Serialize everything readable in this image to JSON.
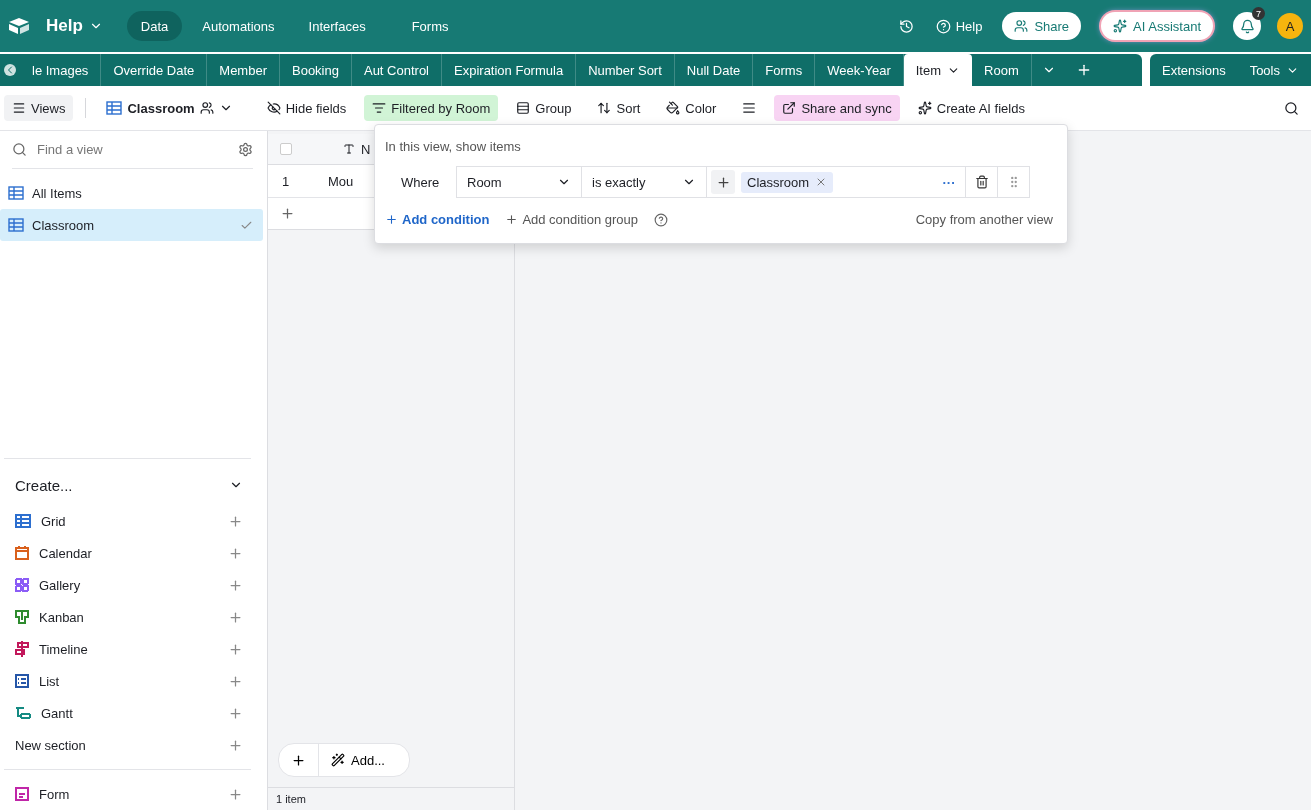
{
  "top_bar": {
    "base_name": "Help",
    "nav": [
      {
        "label": "Data",
        "selected": true
      },
      {
        "label": "Automations",
        "selected": false
      },
      {
        "label": "Interfaces",
        "selected": false
      },
      {
        "label": "Forms",
        "selected": false
      }
    ],
    "help": "Help",
    "share": "Share",
    "ai_assistant": "AI Assistant",
    "notification_count": "7",
    "avatar": "A"
  },
  "table_tabs": {
    "items": [
      {
        "label": "le Images",
        "selected": false,
        "dropdown": false
      },
      {
        "label": "Override Date",
        "selected": false,
        "dropdown": false
      },
      {
        "label": "Member",
        "selected": false,
        "dropdown": false
      },
      {
        "label": "Booking",
        "selected": false,
        "dropdown": false
      },
      {
        "label": "Aut Control",
        "selected": false,
        "dropdown": false
      },
      {
        "label": "Expiration Formula",
        "selected": false,
        "dropdown": false
      },
      {
        "label": "Number Sort",
        "selected": false,
        "dropdown": false
      },
      {
        "label": "Null Date",
        "selected": false,
        "dropdown": false
      },
      {
        "label": "Forms",
        "selected": false,
        "dropdown": false
      },
      {
        "label": "Week-Year",
        "selected": false,
        "dropdown": false
      },
      {
        "label": "Item",
        "selected": true,
        "dropdown": true
      },
      {
        "label": "Room",
        "selected": false,
        "dropdown": false
      }
    ],
    "extensions": "Extensions",
    "tools": "Tools"
  },
  "toolbar": {
    "views": "Views",
    "view_name": "Classroom",
    "items": [
      {
        "kind": "hide",
        "label": "Hide fields",
        "active": false
      },
      {
        "kind": "filter",
        "label": "Filtered by Room",
        "active": true
      },
      {
        "kind": "group",
        "label": "Group",
        "active": false
      },
      {
        "kind": "sort",
        "label": "Sort",
        "active": false
      },
      {
        "kind": "color",
        "label": "Color",
        "active": false
      },
      {
        "kind": "height",
        "active": false
      },
      {
        "kind": "share",
        "label": "Share and sync",
        "active": true
      },
      {
        "kind": "ai",
        "label": "Create AI fields",
        "active": false
      }
    ]
  },
  "sidebar": {
    "search": {
      "placeholder": "Find a view"
    },
    "views": [
      {
        "label": "All Items",
        "selected": false
      },
      {
        "label": "Classroom",
        "selected": true
      }
    ],
    "create_title": "Create...",
    "create_items": [
      {
        "kind": "grid",
        "label": "Grid",
        "color": "#2d6fcf"
      },
      {
        "kind": "calendar",
        "label": "Calendar",
        "color": "#d9601c"
      },
      {
        "kind": "gallery",
        "label": "Gallery",
        "color": "#8b5cf6"
      },
      {
        "kind": "kanban",
        "label": "Kanban",
        "color": "#2e8b2e"
      },
      {
        "kind": "timeline",
        "label": "Timeline",
        "color": "#c2185b"
      },
      {
        "kind": "list",
        "label": "List",
        "color": "#2556a8"
      },
      {
        "kind": "gantt",
        "label": "Gantt",
        "color": "#148a82"
      },
      {
        "kind": "section",
        "label": "New section"
      },
      {
        "kind": "form",
        "label": "Form",
        "color": "#c026a8"
      }
    ]
  },
  "grid": {
    "select_all_checked": false,
    "column_header": "N",
    "rows": [
      {
        "number": "1",
        "cell": "Mou"
      }
    ],
    "add_label": "Add...",
    "record_count": "1 item"
  },
  "filter_popover": {
    "title": "In this view, show items",
    "conditions": [
      {
        "prefix": "Where",
        "field": "Room",
        "operator": "is exactly",
        "values": [
          "Classroom"
        ],
        "more": "···"
      }
    ],
    "add_condition": "Add condition",
    "add_group": "Add condition group",
    "copy": "Copy from another view"
  }
}
